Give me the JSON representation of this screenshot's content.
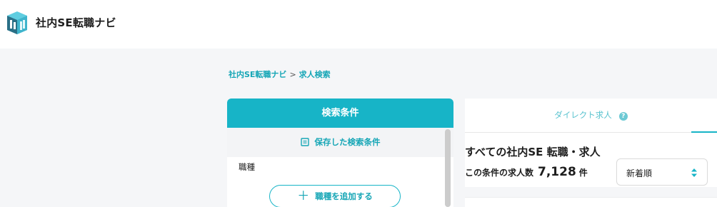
{
  "header": {
    "brand": "社内SE転職ナビ",
    "logo_icon": "site-logo-icon",
    "colors": {
      "logo_dark": "#2a6f86",
      "logo_light": "#5fcde0"
    }
  },
  "breadcrumb": {
    "items": [
      "社内SE転職ナビ",
      "求人検索"
    ],
    "separator": ">"
  },
  "search_panel": {
    "title": "検索条件",
    "saved_label": "保存した検索条件",
    "saved_icon": "saved-list-icon",
    "field_label": "職種",
    "add_button_label": "職種を追加する",
    "accent_color": "#17b4c7"
  },
  "results": {
    "tab_label": "ダイレクト求人",
    "help_icon_glyph": "?",
    "title": "すべての社内SE 転職・求人",
    "count_prefix": "この条件の求人数",
    "count": "7,128",
    "count_unit": "件",
    "sort_selected": "新着順"
  }
}
